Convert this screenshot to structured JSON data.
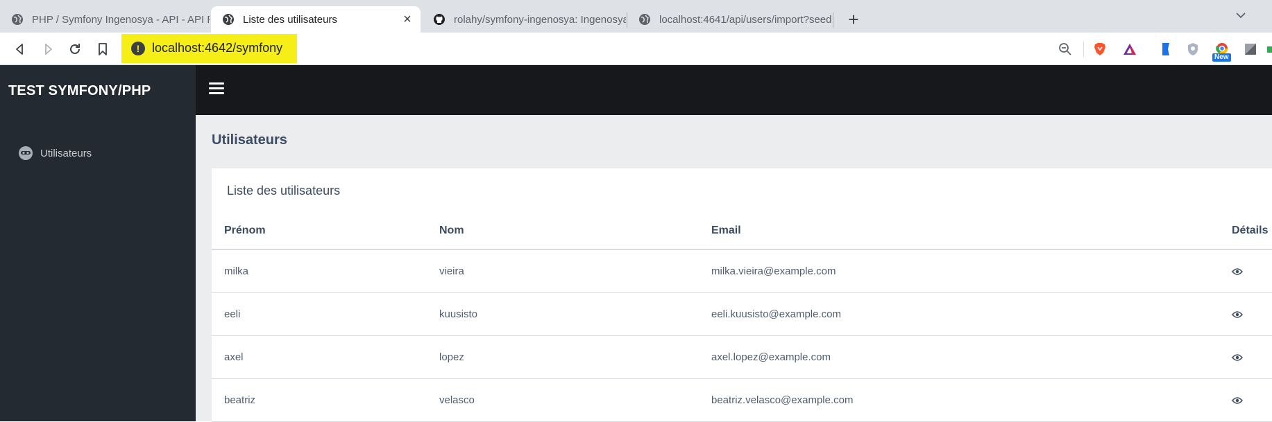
{
  "browser": {
    "tabs": [
      {
        "title": "PHP / Symfony Ingenosya - API - API P",
        "favicon": "globe-icon",
        "active": false
      },
      {
        "title": "Liste des utilisateurs",
        "favicon": "globe-icon",
        "active": true,
        "close": "×"
      },
      {
        "title": "rolahy/symfony-ingenosya: Ingenosya",
        "favicon": "github-icon",
        "active": false
      },
      {
        "title": "localhost:4641/api/users/import?seed",
        "favicon": "globe-icon",
        "active": false
      }
    ],
    "new_tab": "+",
    "address": {
      "url": "localhost:4642/symfony",
      "info_badge": "!",
      "highlight_color": "#f5ef17"
    },
    "extensions": [
      "zoom-out-icon",
      "brave-shield-icon",
      "brave-rewards-icon",
      "bookmark-ext-icon",
      "shield-ext-icon",
      "chromium-new-icon",
      "grey-ext-icon"
    ],
    "new_badge": "New"
  },
  "app": {
    "brand": "TEST SYMFONY/PHP",
    "sidebar": {
      "items": [
        {
          "label": "Utilisateurs",
          "icon": "user-face-icon"
        }
      ]
    },
    "page_title": "Utilisateurs",
    "card_title": "Liste des utilisateurs",
    "table": {
      "headers": [
        "Prénom",
        "Nom",
        "Email",
        "Détails"
      ],
      "rows": [
        [
          "milka",
          "vieira",
          "milka.vieira@example.com"
        ],
        [
          "eeli",
          "kuusisto",
          "eeli.kuusisto@example.com"
        ],
        [
          "axel",
          "lopez",
          "axel.lopez@example.com"
        ],
        [
          "beatriz",
          "velasco",
          "beatriz.velasco@example.com"
        ]
      ]
    },
    "colors": {
      "sidebar": "#232a32",
      "topbar": "#16181b",
      "content_bg": "#ebedef",
      "heading": "#3c4b64"
    }
  }
}
